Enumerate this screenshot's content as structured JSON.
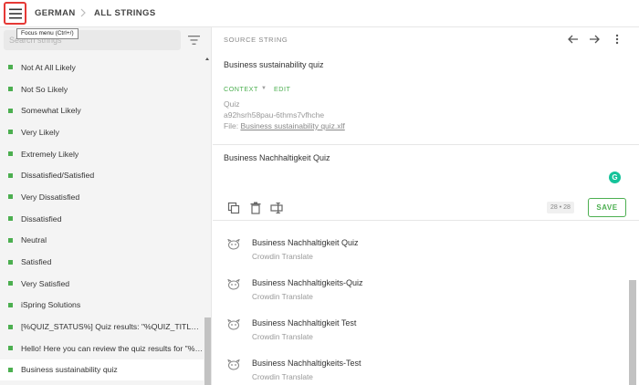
{
  "header": {
    "menu_tooltip": "Focus menu (Ctrl+/)",
    "breadcrumb": [
      "GERMAN",
      "ALL STRINGS"
    ]
  },
  "sidebar": {
    "search_placeholder": "Search strings",
    "items": [
      {
        "label": "Not At All Likely",
        "status_color": "#4caf50"
      },
      {
        "label": "Not So Likely",
        "status_color": "#4caf50"
      },
      {
        "label": "Somewhat Likely",
        "status_color": "#4caf50"
      },
      {
        "label": "Very Likely",
        "status_color": "#4caf50"
      },
      {
        "label": "Extremely Likely",
        "status_color": "#4caf50"
      },
      {
        "label": "Dissatisfied/Satisfied",
        "status_color": "#4caf50"
      },
      {
        "label": "Very Dissatisfied",
        "status_color": "#4caf50"
      },
      {
        "label": "Dissatisfied",
        "status_color": "#4caf50"
      },
      {
        "label": "Neutral",
        "status_color": "#4caf50"
      },
      {
        "label": "Satisfied",
        "status_color": "#4caf50"
      },
      {
        "label": "Very Satisfied",
        "status_color": "#4caf50"
      },
      {
        "label": "iSpring Solutions",
        "status_color": "#4caf50"
      },
      {
        "label": "[%QUIZ_STATUS%] Quiz results: \"%QUIZ_TITLE%\"",
        "status_color": "#4caf50"
      },
      {
        "label": "Hello! Here you can review the quiz results for \"%QUIZ_TITLE%\"",
        "status_color": "#4caf50"
      },
      {
        "label": "Business sustainability quiz",
        "status_color": "#4caf50",
        "active": true
      }
    ]
  },
  "source": {
    "title": "SOURCE STRING",
    "text": "Business sustainability quiz",
    "context_label": "CONTEXT",
    "edit_label": "EDIT",
    "context_name": "Quiz",
    "context_id": "a92hsrh58pau-6thms7vfhche",
    "file_prefix": "File:",
    "file_name": "Business sustainability quiz.xlf"
  },
  "editor": {
    "translation": "Business Nachhaltigkeit Quiz",
    "grammarly_letter": "G",
    "char_count": "28 • 28",
    "save_label": "SAVE"
  },
  "suggestions": [
    {
      "text": "Business Nachhaltigkeit Quiz",
      "source": "Crowdin Translate"
    },
    {
      "text": "Business Nachhaltigkeits-Quiz",
      "source": "Crowdin Translate"
    },
    {
      "text": "Business Nachhaltigkeit Test",
      "source": "Crowdin Translate"
    },
    {
      "text": "Business Nachhaltigkeits-Test",
      "source": "Crowdin Translate"
    }
  ],
  "colors": {
    "accent_green": "#4caf50",
    "focus_outline": "#e53935",
    "grammarly": "#15c39a"
  }
}
